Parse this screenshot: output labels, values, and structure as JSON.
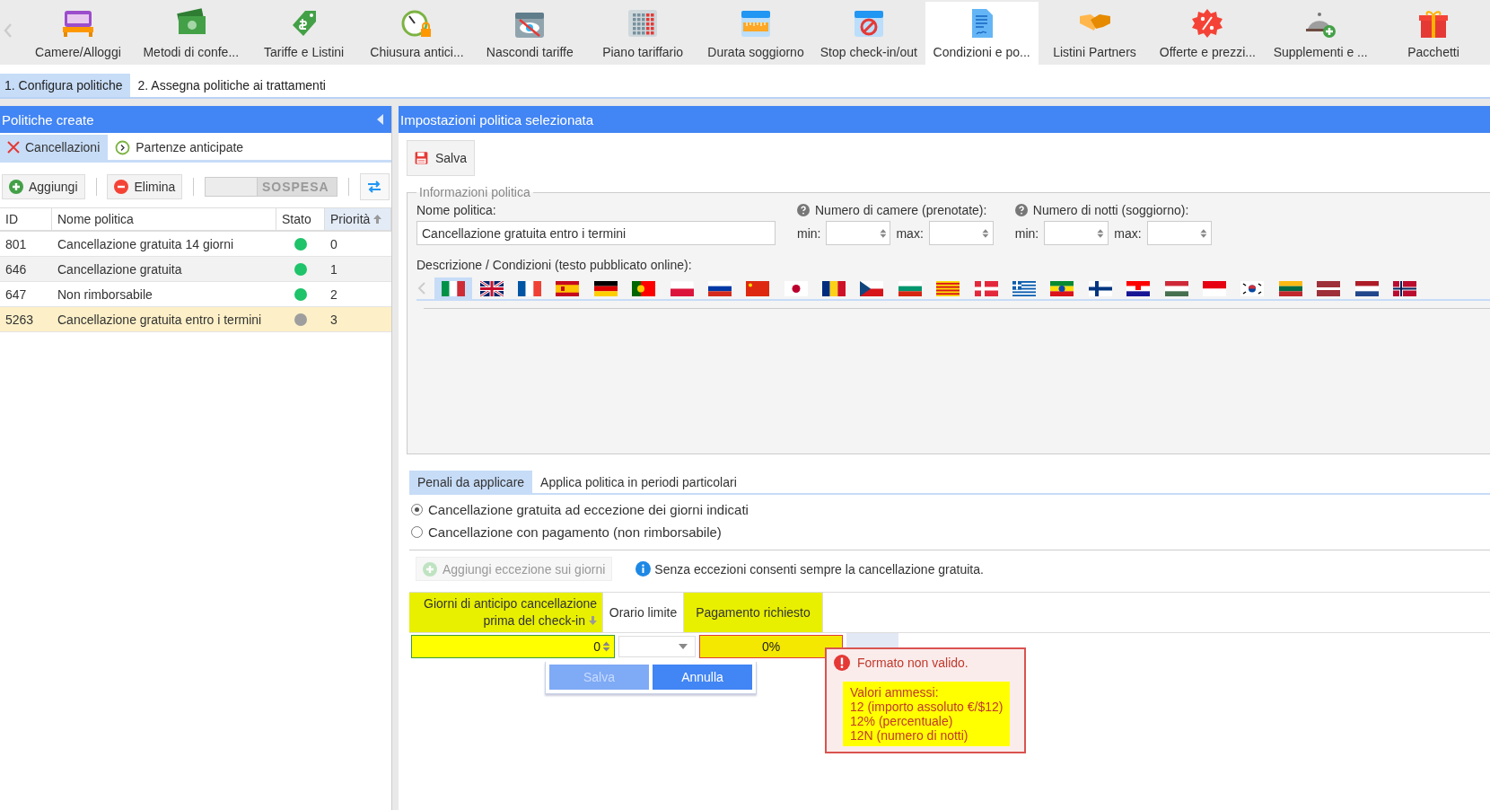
{
  "toolbar": {
    "items": [
      {
        "label": "Camere/Alloggi",
        "kind": "bed",
        "selected": false
      },
      {
        "label": "Metodi di confe...",
        "kind": "cash",
        "selected": false
      },
      {
        "label": "Tariffe e Listini",
        "kind": "tag",
        "selected": false
      },
      {
        "label": "Chiusura antici...",
        "kind": "stopwatch",
        "selected": false
      },
      {
        "label": "Nascondi tariffe",
        "kind": "hidden",
        "selected": false
      },
      {
        "label": "Piano tariffario",
        "kind": "grid",
        "selected": false
      },
      {
        "label": "Durata soggiorno",
        "kind": "ruler",
        "selected": false
      },
      {
        "label": "Stop check-in/out",
        "kind": "blocked",
        "selected": false
      },
      {
        "label": "Condizioni e po...",
        "kind": "document",
        "selected": true
      },
      {
        "label": "Listini Partners",
        "kind": "handshake",
        "selected": false
      },
      {
        "label": "Offerte e prezzi...",
        "kind": "discount",
        "selected": false
      },
      {
        "label": "Supplementi e ...",
        "kind": "bell",
        "selected": false
      },
      {
        "label": "Pacchetti",
        "kind": "gift",
        "selected": false
      }
    ]
  },
  "steps": [
    {
      "label": "1. Configura politiche",
      "selected": true
    },
    {
      "label": "2. Assegna politiche ai trattamenti",
      "selected": false
    }
  ],
  "left_panel": {
    "title": "Politiche create",
    "tabs": [
      {
        "label": "Cancellazioni",
        "kind": "cancel",
        "selected": true
      },
      {
        "label": "Partenze anticipate",
        "kind": "clock",
        "selected": false
      }
    ],
    "add_button": "Aggiungi",
    "delete_button": "Elimina",
    "toggle": {
      "label": "SOSPESA",
      "on": false
    },
    "table": {
      "columns": [
        {
          "label": "ID",
          "sorted": false
        },
        {
          "label": "Nome politica",
          "sorted": false
        },
        {
          "label": "Stato",
          "sorted": false
        },
        {
          "label": "Priorità",
          "sorted": true
        }
      ],
      "rows": [
        {
          "id": "801",
          "name": "Cancellazione gratuita 14 giorni",
          "color": "#1ec36a",
          "priority": "0",
          "selected": false
        },
        {
          "id": "646",
          "name": "Cancellazione gratuita",
          "color": "#1ec36a",
          "priority": "1",
          "selected": false
        },
        {
          "id": "647",
          "name": "Non rimborsabile",
          "color": "#1ec36a",
          "priority": "2",
          "selected": false
        },
        {
          "id": "5263",
          "name": "Cancellazione gratuita entro i termini",
          "color": "#9e9e9e",
          "priority": "3",
          "selected": true
        }
      ]
    }
  },
  "right_panel": {
    "title": "Impostazioni politica selezionata",
    "save_button": "Salva",
    "info_section": {
      "legend": "Informazioni politica",
      "name_label": "Nome politica:",
      "name_value": "Cancellazione gratuita entro i termini",
      "rooms": {
        "label": "Numero di camere (prenotate):",
        "min_label": "min:",
        "max_label": "max:"
      },
      "nights": {
        "label": "Numero di notti (soggiorno):",
        "min_label": "min:",
        "max_label": "max:"
      },
      "description_label": "Descrizione / Condizioni (testo pubblicato online):",
      "flags": [
        {
          "kind": "it",
          "selected": true
        },
        {
          "kind": "gb",
          "selected": false
        },
        {
          "kind": "fr",
          "selected": false
        },
        {
          "kind": "es",
          "selected": false
        },
        {
          "kind": "de",
          "selected": false
        },
        {
          "kind": "pt",
          "selected": false
        },
        {
          "kind": "pl",
          "selected": false
        },
        {
          "kind": "ru",
          "selected": false
        },
        {
          "kind": "cn",
          "selected": false
        },
        {
          "kind": "jp",
          "selected": false
        },
        {
          "kind": "ro",
          "selected": false
        },
        {
          "kind": "cz",
          "selected": false
        },
        {
          "kind": "bg",
          "selected": false
        },
        {
          "kind": "cat",
          "selected": false
        },
        {
          "kind": "dk",
          "selected": false
        },
        {
          "kind": "gr",
          "selected": false
        },
        {
          "kind": "et",
          "selected": false
        },
        {
          "kind": "fi",
          "selected": false
        },
        {
          "kind": "hr",
          "selected": false
        },
        {
          "kind": "hu",
          "selected": false
        },
        {
          "kind": "id",
          "selected": false
        },
        {
          "kind": "kr",
          "selected": false
        },
        {
          "kind": "lt",
          "selected": false
        },
        {
          "kind": "lv",
          "selected": false
        },
        {
          "kind": "nl",
          "selected": false
        },
        {
          "kind": "no",
          "selected": false
        }
      ]
    },
    "tabs": [
      {
        "label": "Penali da applicare",
        "selected": true
      },
      {
        "label": "Applica politica in periodi particolari",
        "selected": false
      }
    ],
    "options": [
      {
        "label": "Cancellazione gratuita ad eccezione dei giorni indicati",
        "selected": true
      },
      {
        "label": "Cancellazione con pagamento (non rimborsabile)",
        "selected": false
      }
    ],
    "add_exception": {
      "label": "Aggiungi eccezione sui giorni",
      "disabled": true
    },
    "info": "Senza eccezioni consenti sempre la cancellazione gratuita.",
    "grid": {
      "columns": [
        {
          "label": "Giorni di anticipo cancellazione prima del check-in",
          "highlighted": true
        },
        {
          "label": "Orario limite",
          "highlighted": false
        },
        {
          "label": "Pagamento richiesto",
          "highlighted": true
        }
      ],
      "days_value": "0",
      "payment_value": "0%",
      "payment_invalid": true,
      "buttons": [
        {
          "label": "Salva",
          "disabled": true
        },
        {
          "label": "Annulla",
          "disabled": false
        }
      ]
    },
    "error": {
      "title": "Formato non valido.",
      "lines": [
        "Valori ammessi:",
        "12 (importo assoluto €/$12)",
        "12% (percentuale)",
        "12N (numero di notti)"
      ]
    }
  }
}
